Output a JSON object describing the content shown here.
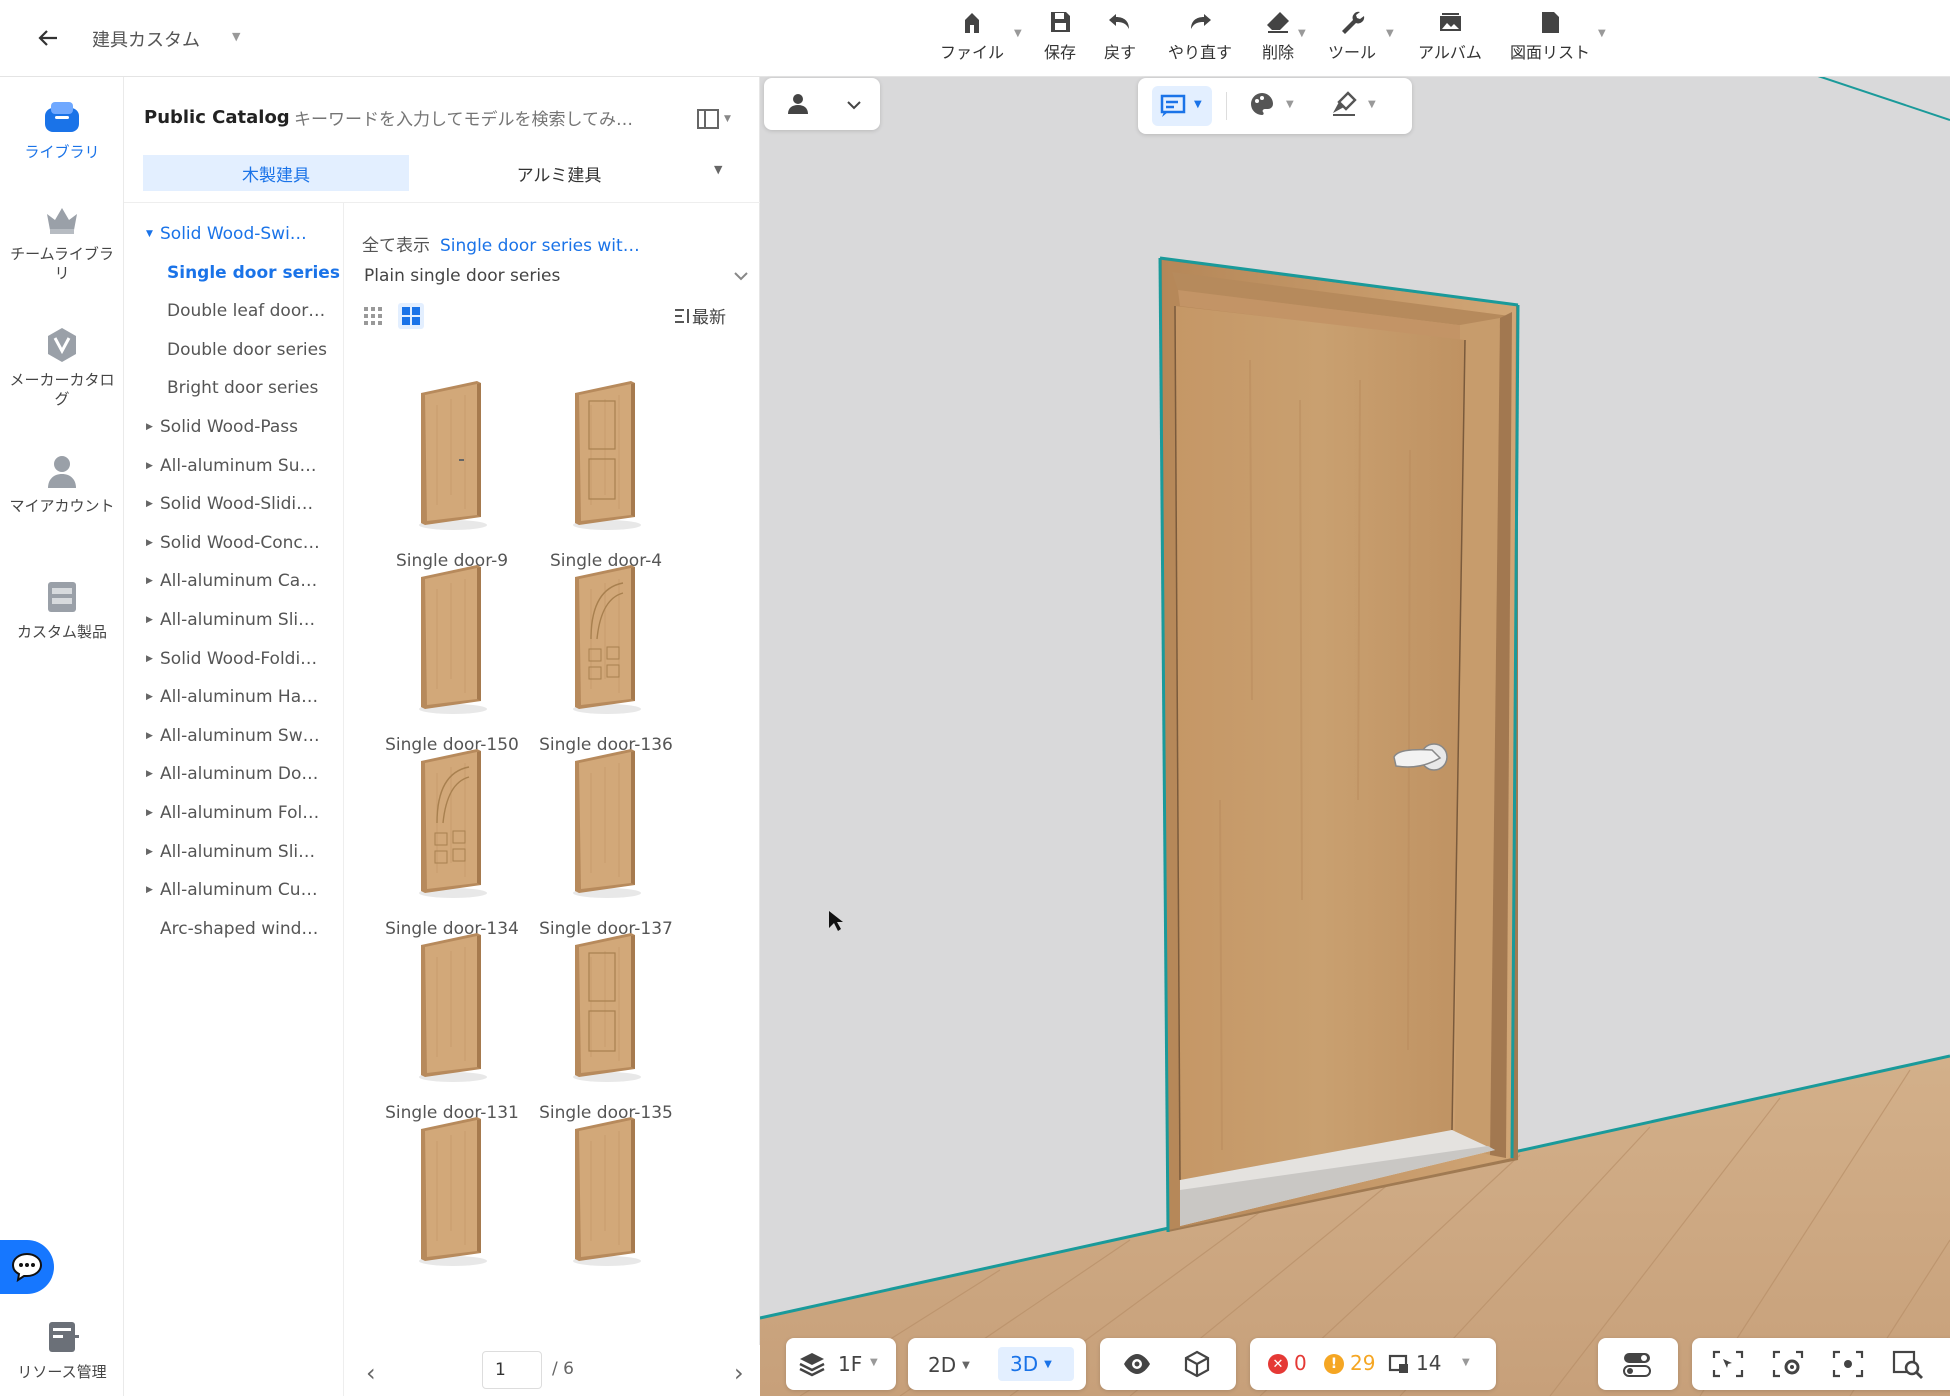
{
  "header": {
    "project_name": "建具カスタム",
    "toolbar": [
      {
        "id": "file",
        "label": "ファイル",
        "icon": "house-file-icon",
        "has_menu": true
      },
      {
        "id": "save",
        "label": "保存",
        "icon": "save-icon",
        "has_menu": false
      },
      {
        "id": "undo",
        "label": "戻す",
        "icon": "undo-icon",
        "has_menu": false
      },
      {
        "id": "redo",
        "label": "やり直す",
        "icon": "redo-icon",
        "has_menu": false
      },
      {
        "id": "delete",
        "label": "削除",
        "icon": "eraser-icon",
        "has_menu": true
      },
      {
        "id": "tools",
        "label": "ツール",
        "icon": "wrench-icon",
        "has_menu": true
      },
      {
        "id": "album",
        "label": "アルバム",
        "icon": "album-icon",
        "has_menu": false
      },
      {
        "id": "drawings",
        "label": "図面リスト",
        "icon": "drawing-list-icon",
        "has_menu": true
      }
    ]
  },
  "left_nav": {
    "items": [
      {
        "label": "ライブラリ",
        "icon": "library-icon",
        "active": true
      },
      {
        "label": "チームライブラリ",
        "icon": "team-library-icon",
        "active": false
      },
      {
        "label": "メーカーカタログ",
        "icon": "maker-catalog-icon",
        "active": false
      },
      {
        "label": "マイアカウント",
        "icon": "my-account-icon",
        "active": false
      },
      {
        "label": "カスタム製品",
        "icon": "custom-product-icon",
        "active": false
      }
    ],
    "bottom": {
      "label": "リソース管理",
      "icon": "resource-manage-icon"
    }
  },
  "catalog": {
    "title": "Public Catalog",
    "search_placeholder": "キーワードを入力してモデルを検索してみ…",
    "tabs": [
      {
        "label": "木製建具",
        "active": true
      },
      {
        "label": "アルミ建具",
        "active": false
      }
    ],
    "tree": [
      {
        "label": "Solid Wood-Swi…",
        "level": 0,
        "expanded": true
      },
      {
        "label": "Single door series",
        "level": 1,
        "active": true
      },
      {
        "label": "Double leaf door…",
        "level": 1
      },
      {
        "label": "Double door series",
        "level": 1
      },
      {
        "label": "Bright door series",
        "level": 1
      },
      {
        "label": "Solid Wood-Pass",
        "level": 0
      },
      {
        "label": "All-aluminum Su…",
        "level": 0
      },
      {
        "label": "Solid Wood-Slidi…",
        "level": 0
      },
      {
        "label": "Solid Wood-Conc…",
        "level": 0
      },
      {
        "label": "All-aluminum Ca…",
        "level": 0
      },
      {
        "label": "All-aluminum Sli…",
        "level": 0
      },
      {
        "label": "Solid Wood-Foldi…",
        "level": 0
      },
      {
        "label": "All-aluminum Ha…",
        "level": 0
      },
      {
        "label": "All-aluminum Sw…",
        "level": 0
      },
      {
        "label": "All-aluminum Do…",
        "level": 0
      },
      {
        "label": "All-aluminum Fol…",
        "level": 0
      },
      {
        "label": "All-aluminum Sli…",
        "level": 0
      },
      {
        "label": "All-aluminum Cu…",
        "level": 0
      },
      {
        "label": "Arc-shaped wind…",
        "level": 0,
        "leaf": true
      }
    ],
    "breadcrumb": {
      "show_all": "全て表示",
      "current": "Single door series wit…"
    },
    "subcategory": "Plain single door series",
    "sort_label": "最新",
    "products": [
      {
        "name": "Single door-9",
        "style": "plain-handle"
      },
      {
        "name": "Single door-4",
        "style": "panel"
      },
      {
        "name": "Single door-150",
        "style": "plain"
      },
      {
        "name": "Single door-136",
        "style": "arch-grid"
      },
      {
        "name": "Single door-134",
        "style": "arch-grid"
      },
      {
        "name": "Single door-137",
        "style": "plain"
      },
      {
        "name": "Single door-131",
        "style": "plain"
      },
      {
        "name": "Single door-135",
        "style": "panel"
      },
      {
        "name": "",
        "style": "plain"
      },
      {
        "name": "",
        "style": "plain"
      }
    ],
    "pager": {
      "current": "1",
      "total": "/ 6"
    }
  },
  "viewport": {
    "floor": "1F",
    "view_2d": "2D",
    "view_3d": "3D",
    "error_count": "0",
    "warning_count": "29",
    "object_count": "14",
    "colors": {
      "wall": "#d9d9da",
      "floor": "#c9a27a",
      "door": "#c8996a",
      "accent": "#1a73e8",
      "teal": "#1a9a9a"
    }
  }
}
